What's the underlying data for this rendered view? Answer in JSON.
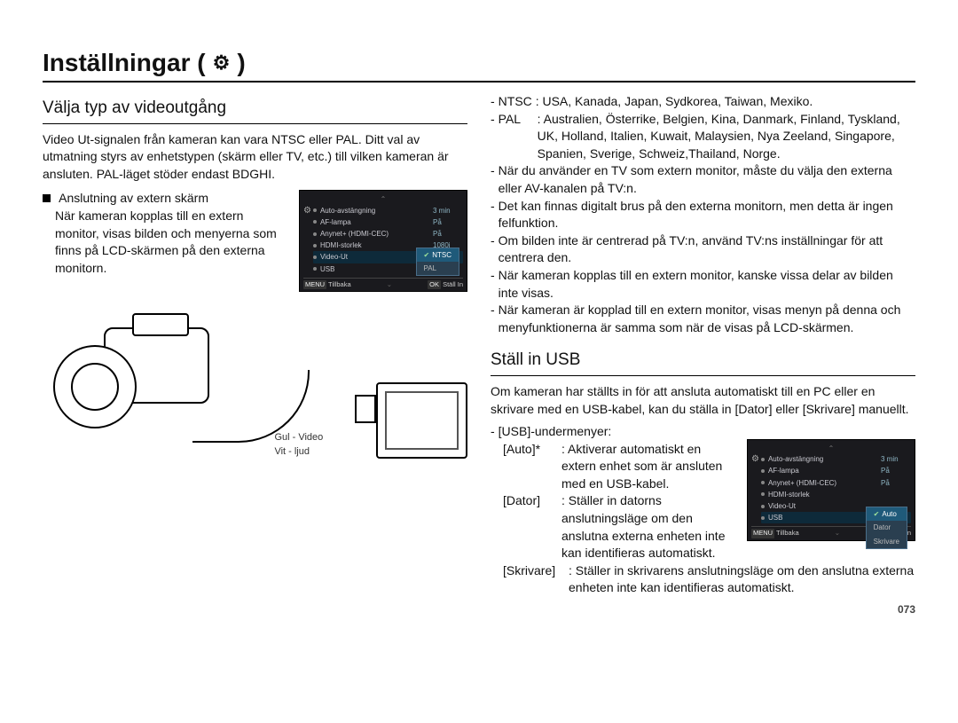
{
  "header": {
    "title": "Inställningar (",
    "title_suffix": ")",
    "gear_glyph": "⚙"
  },
  "left": {
    "heading": "Välja typ av videoutgång",
    "intro": "Video Ut-signalen från kameran kan vara NTSC eller PAL. Ditt val av utmatning styrs av enhetstypen (skärm eller TV, etc.) till vilken kameran är ansluten. PAL-läget stöder endast BDGHI.",
    "ext_title": "Anslutning av extern skärm",
    "ext_body": "När kameran kopplas till en extern monitor, visas bilden och menyerna som finns på LCD-skärmen på den externa monitorn.",
    "illustration_labels": {
      "video": "Gul - Video",
      "audio": "Vit - ljud"
    }
  },
  "right": {
    "ntsc_label": "NTSC",
    "ntsc_text": ": USA, Kanada, Japan, Sydkorea, Taiwan, Mexiko.",
    "pal_label": "PAL",
    "pal_text": ": Australien, Österrike, Belgien, Kina, Danmark, Finland, Tyskland, UK, Holland, Italien, Kuwait, Malaysien, Nya Zeeland, Singapore, Spanien, Sverige, Schweiz,Thailand, Norge.",
    "notes": [
      "När du använder en TV som extern monitor, måste du välja den externa eller AV-kanalen på TV:n.",
      "Det kan finnas digitalt brus på den externa monitorn, men detta är ingen felfunktion.",
      "Om bilden inte är centrerad på TV:n, använd TV:ns inställningar för att centrera den.",
      "När kameran kopplas till en extern monitor, kanske vissa delar av bilden inte visas.",
      "När kameran är kopplad till en extern monitor, visas menyn på denna och menyfunktionerna är samma som när de visas på LCD-skärmen."
    ],
    "usb_heading": "Ställ in USB",
    "usb_intro": "Om kameran har ställts in för att ansluta automatiskt till en PC eller en skrivare med en USB-kabel, kan du ställa in [Dator] eller [Skrivare] manuellt.",
    "usb_sub_label": "[USB]-undermenyer:",
    "usb_defs": [
      {
        "key": "[Auto]*",
        "body": ": Aktiverar automatiskt en extern enhet som är ansluten med en USB-kabel."
      },
      {
        "key": "[Dator]",
        "body": ": Ställer in datorns anslutningsläge om den anslutna externa enheten inte kan identifieras automatiskt."
      },
      {
        "key": "[Skrivare]",
        "body": ": Ställer in skrivarens anslutningsläge om den anslutna externa enheten inte kan identifieras automatiskt."
      }
    ]
  },
  "menuA": {
    "items": [
      {
        "label": "Auto-avstängning",
        "value": "3 min"
      },
      {
        "label": "AF-lampa",
        "value": "På"
      },
      {
        "label": "Anynet+ (HDMI-CEC)",
        "value": "På"
      },
      {
        "label": "HDMI-storlek",
        "value": "1080i"
      },
      {
        "label": "Video-Ut",
        "value": "",
        "selected": true
      },
      {
        "label": "USB",
        "value": ""
      }
    ],
    "popup": [
      "NTSC",
      "PAL"
    ],
    "popup_selected": 0,
    "footer_back_key": "MENU",
    "footer_back": "Tillbaka",
    "footer_ok_key": "OK",
    "footer_ok": "Ställ In"
  },
  "menuB": {
    "items": [
      {
        "label": "Auto-avstängning",
        "value": "3 min"
      },
      {
        "label": "AF-lampa",
        "value": "På"
      },
      {
        "label": "Anynet+ (HDMI-CEC)",
        "value": "På"
      },
      {
        "label": "HDMI-storlek",
        "value": ""
      },
      {
        "label": "Video-Ut",
        "value": ""
      },
      {
        "label": "USB",
        "value": "",
        "selected": true
      }
    ],
    "popup": [
      "Auto",
      "Dator",
      "Skrivare"
    ],
    "popup_selected": 0,
    "footer_back_key": "MENU",
    "footer_back": "Tillbaka",
    "footer_ok_key": "OK",
    "footer_ok": "Ställ In"
  },
  "page_number": "073"
}
